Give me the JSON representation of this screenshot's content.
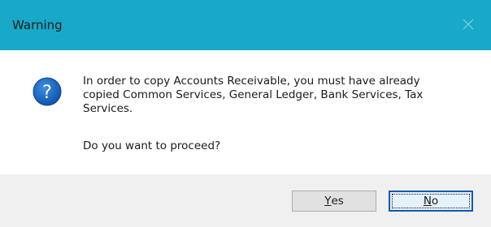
{
  "window": {
    "title": "Warning"
  },
  "message": {
    "body": "In order to copy Accounts Receivable, you must have already\ncopied Common Services, General Ledger, Bank Services, Tax\nServices.",
    "question": "Do you want to proceed?"
  },
  "buttons": {
    "yes": {
      "accel": "Y",
      "rest": "es"
    },
    "no": {
      "accel": "N",
      "rest": "o"
    }
  },
  "colors": {
    "titlebar": "#18a9c9",
    "footer": "#f0f0f0",
    "icon": "#1565c0",
    "focus_border": "#0a5ab8"
  },
  "icons": {
    "dialog_icon": "question-icon",
    "close_icon": "close-icon"
  }
}
